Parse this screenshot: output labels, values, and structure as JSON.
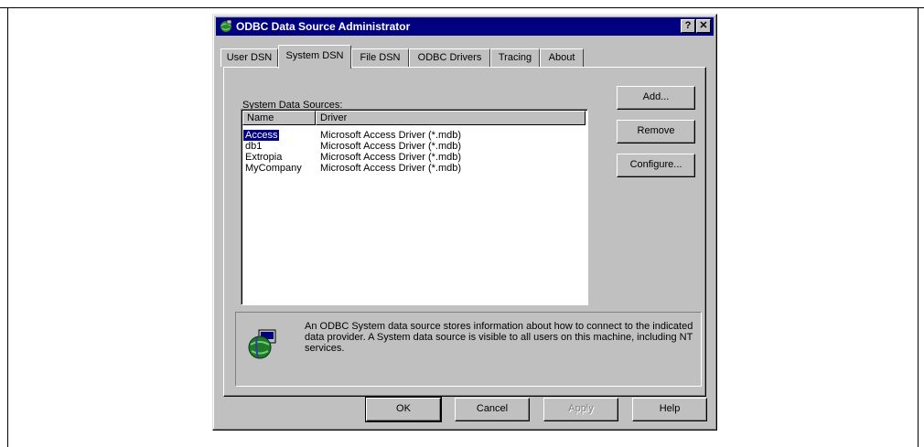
{
  "window": {
    "title": "ODBC Data Source Administrator",
    "help_button": "?",
    "close_button": "✕"
  },
  "tabs": [
    {
      "label": "User DSN"
    },
    {
      "label": "System DSN",
      "active": true
    },
    {
      "label": "File DSN"
    },
    {
      "label": "ODBC Drivers"
    },
    {
      "label": "Tracing"
    },
    {
      "label": "About"
    }
  ],
  "panel": {
    "list_label": "System Data Sources:",
    "columns": [
      "Name",
      "Driver"
    ],
    "rows": [
      {
        "name": "Access",
        "driver": "Microsoft Access Driver (*.mdb)",
        "selected": true
      },
      {
        "name": "db1",
        "driver": "Microsoft Access Driver (*.mdb)"
      },
      {
        "name": "Extropia",
        "driver": "Microsoft Access Driver (*.mdb)"
      },
      {
        "name": "MyCompany",
        "driver": "Microsoft Access Driver (*.mdb)"
      }
    ],
    "side_buttons": {
      "add": "Add...",
      "remove": "Remove",
      "configure": "Configure..."
    },
    "info_text": "An ODBC System data source stores information about how to connect to the indicated data provider.   A System data source is visible to all users on this machine, including NT services."
  },
  "footer_buttons": {
    "ok": "OK",
    "cancel": "Cancel",
    "apply": "Apply",
    "help": "Help"
  },
  "colors": {
    "titlebar": "#000080",
    "face": "#c0c0c0",
    "selection": "#000080"
  },
  "icons": {
    "title": "odbc-globe-icon",
    "info": "odbc-globe-icon"
  }
}
